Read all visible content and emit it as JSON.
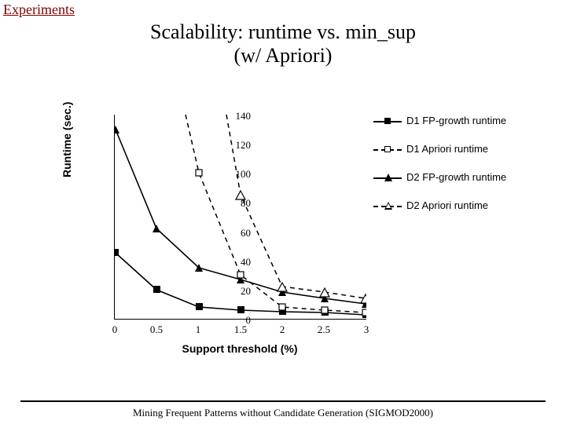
{
  "section": "Experiments",
  "title_l1": "Scalability: runtime vs. min_sup",
  "title_l2": "(w/ Apriori)",
  "ylabel": "Runtime (sec.)",
  "xlabel": "Support threshold (%)",
  "footer": "Mining Frequent Patterns without Candidate Generation (SIGMOD2000)",
  "legend": {
    "s1": "D1 FP-growth runtime",
    "s2": "D1 Apriori runtime",
    "s3": "D2 FP-growth runtime",
    "s4": "D2 Apriori runtime"
  },
  "yticks": [
    "0",
    "20",
    "40",
    "60",
    "80",
    "100",
    "120",
    "140"
  ],
  "xticks": [
    "0",
    "0.5",
    "1",
    "1.5",
    "2",
    "2.5",
    "3"
  ],
  "chart_data": {
    "type": "line",
    "xlabel": "Support threshold (%)",
    "ylabel": "Runtime (sec.)",
    "xlim": [
      0,
      3
    ],
    "ylim": [
      0,
      140
    ],
    "categories": [
      0,
      0.5,
      1,
      1.5,
      2,
      2.5,
      3
    ],
    "series": [
      {
        "name": "D1 FP-growth runtime",
        "marker": "filled-square",
        "line": "solid",
        "values": [
          45,
          20,
          8,
          6,
          5,
          4,
          3
        ]
      },
      {
        "name": "D1 Apriori runtime",
        "marker": "open-square",
        "line": "dashed",
        "values": [
          null,
          null,
          100,
          30,
          8,
          6,
          4
        ]
      },
      {
        "name": "D2 FP-growth runtime",
        "marker": "filled-triangle",
        "line": "solid",
        "values": [
          130,
          62,
          35,
          27,
          18,
          14,
          10
        ]
      },
      {
        "name": "D2 Apriori runtime",
        "marker": "open-triangle",
        "line": "dashed",
        "values": [
          null,
          null,
          null,
          85,
          22,
          18,
          14
        ]
      }
    ]
  }
}
